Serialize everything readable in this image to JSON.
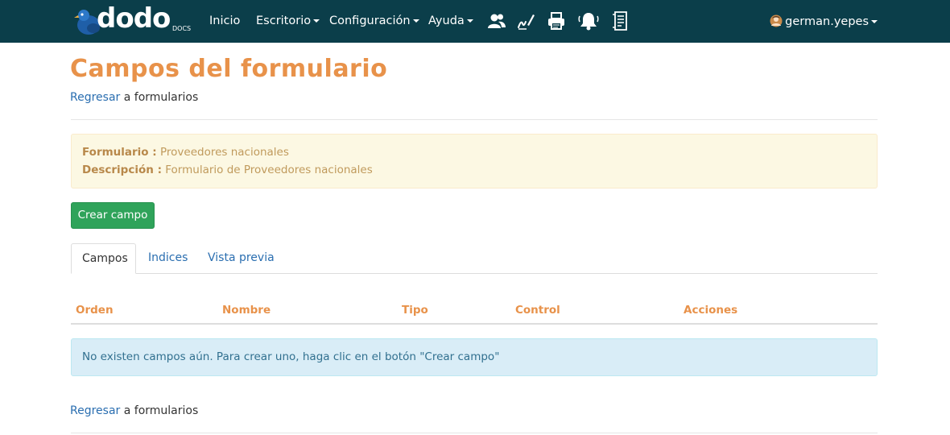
{
  "nav": {
    "logo_text": "dodo",
    "logo_sub": "DOCS",
    "items": [
      {
        "label": "Inicio",
        "dropdown": false
      },
      {
        "label": "Escritorio",
        "dropdown": true
      },
      {
        "label": "Configuración",
        "dropdown": true
      },
      {
        "label": "Ayuda",
        "dropdown": true
      }
    ],
    "icons": [
      "users-icon",
      "signature-icon",
      "printer-icon",
      "bell-icon",
      "document-icon"
    ],
    "user": "german.yepes"
  },
  "page": {
    "title": "Campos del formulario",
    "back_link": "Regresar",
    "back_suffix": " a formularios"
  },
  "info": {
    "form_label": "Formulario :",
    "form_value": " Proveedores nacionales",
    "desc_label": "Descripción :",
    "desc_value": " Formulario de Proveedores nacionales"
  },
  "create_button": "Crear campo",
  "tabs": [
    {
      "label": "Campos",
      "active": true
    },
    {
      "label": "Indices",
      "active": false
    },
    {
      "label": "Vista previa",
      "active": false
    }
  ],
  "table": {
    "columns": [
      "Orden",
      "Nombre",
      "Tipo",
      "Control",
      "Acciones"
    ]
  },
  "empty_message": "No existen campos aún. Para crear uno, haga clic en el botón \"Crear campo\"",
  "colors": {
    "navbar": "#0b3e4a",
    "accent_orange": "#e8924a",
    "link_blue": "#2a6eb0",
    "button_green": "#2fa35a",
    "warning_bg": "#fcf8e3",
    "info_bg": "#d9edf7"
  }
}
